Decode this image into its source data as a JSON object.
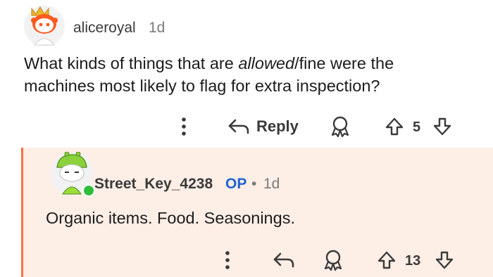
{
  "comment_1": {
    "username": "aliceroyal",
    "age": "1d",
    "body_part1": "What kinds of things that are ",
    "body_emph": "allowed",
    "body_part2": "/fine were the",
    "body_line2": "machines most likely to flag for extra inspection?",
    "reply_label": "Reply",
    "vote_count": "5"
  },
  "comment_2": {
    "username": "Street_Key_4238",
    "op_label": "OP",
    "separator": "•",
    "age": "1d",
    "body": "Organic items. Food. Seasonings.",
    "vote_count": "13"
  },
  "colors": {
    "thread_line": "#ff6f3c",
    "reply_bg": "#fdeee6",
    "op_blue": "#1f63d4",
    "online_green": "#2fbd3a"
  }
}
